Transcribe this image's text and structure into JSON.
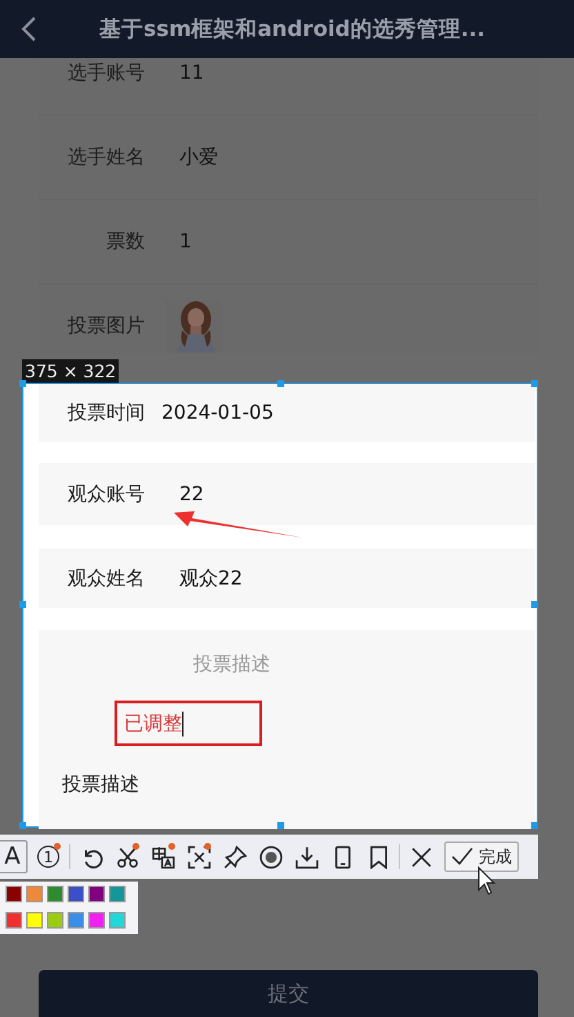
{
  "header": {
    "title": "基于ssm框架和android的选秀管理..."
  },
  "form_rows": [
    {
      "label": "选手账号",
      "value": "11",
      "kind": "text"
    },
    {
      "label": "选手姓名",
      "value": "小爱",
      "kind": "text"
    },
    {
      "label": "票数",
      "value": "1",
      "kind": "text"
    },
    {
      "label": "投票图片",
      "kind": "picture"
    }
  ],
  "selection": {
    "size_label": "375 × 322",
    "rows": [
      {
        "label": "投票时间",
        "value": "2024-01-05"
      },
      {
        "label": "观众账号",
        "value": "22"
      },
      {
        "label": "观众姓名",
        "value": "观众22"
      }
    ],
    "description": {
      "placeholder": "投票描述",
      "label": "投票描述"
    },
    "text_annotation": "已调整"
  },
  "toolbar": {
    "tools": [
      {
        "kind": "text",
        "glyph": "A",
        "selected": true,
        "dot": false
      },
      {
        "kind": "number",
        "glyph": "1",
        "selected": false,
        "dot": true
      },
      {
        "kind": "separator"
      },
      {
        "kind": "undo",
        "selected": false,
        "dot": false
      },
      {
        "kind": "scissors",
        "selected": false,
        "dot": true
      },
      {
        "kind": "translate",
        "selected": false,
        "dot": true
      },
      {
        "kind": "ocr",
        "selected": false,
        "dot": true
      },
      {
        "kind": "pin",
        "selected": false,
        "dot": false
      },
      {
        "kind": "record",
        "selected": false,
        "dot": false
      },
      {
        "kind": "download",
        "selected": false,
        "dot": false
      },
      {
        "kind": "phone",
        "selected": false,
        "dot": false
      },
      {
        "kind": "bookmark",
        "selected": false,
        "dot": false
      },
      {
        "kind": "separator"
      },
      {
        "kind": "close",
        "selected": false,
        "dot": false
      }
    ],
    "done_label": "完成"
  },
  "palette": [
    {
      "color": "#8b0000"
    },
    {
      "color": "#f0883a"
    },
    {
      "color": "#2e8b2e"
    },
    {
      "color": "#3a4fc8"
    },
    {
      "color": "#800080"
    },
    {
      "color": "#14979a"
    },
    {
      "color": "#f03030"
    },
    {
      "color": "#ffff00"
    },
    {
      "color": "#9acd12"
    },
    {
      "color": "#3a8ee8"
    },
    {
      "color": "#f020f0"
    },
    {
      "color": "#20d8d8"
    }
  ],
  "submit": {
    "label": "提交"
  }
}
